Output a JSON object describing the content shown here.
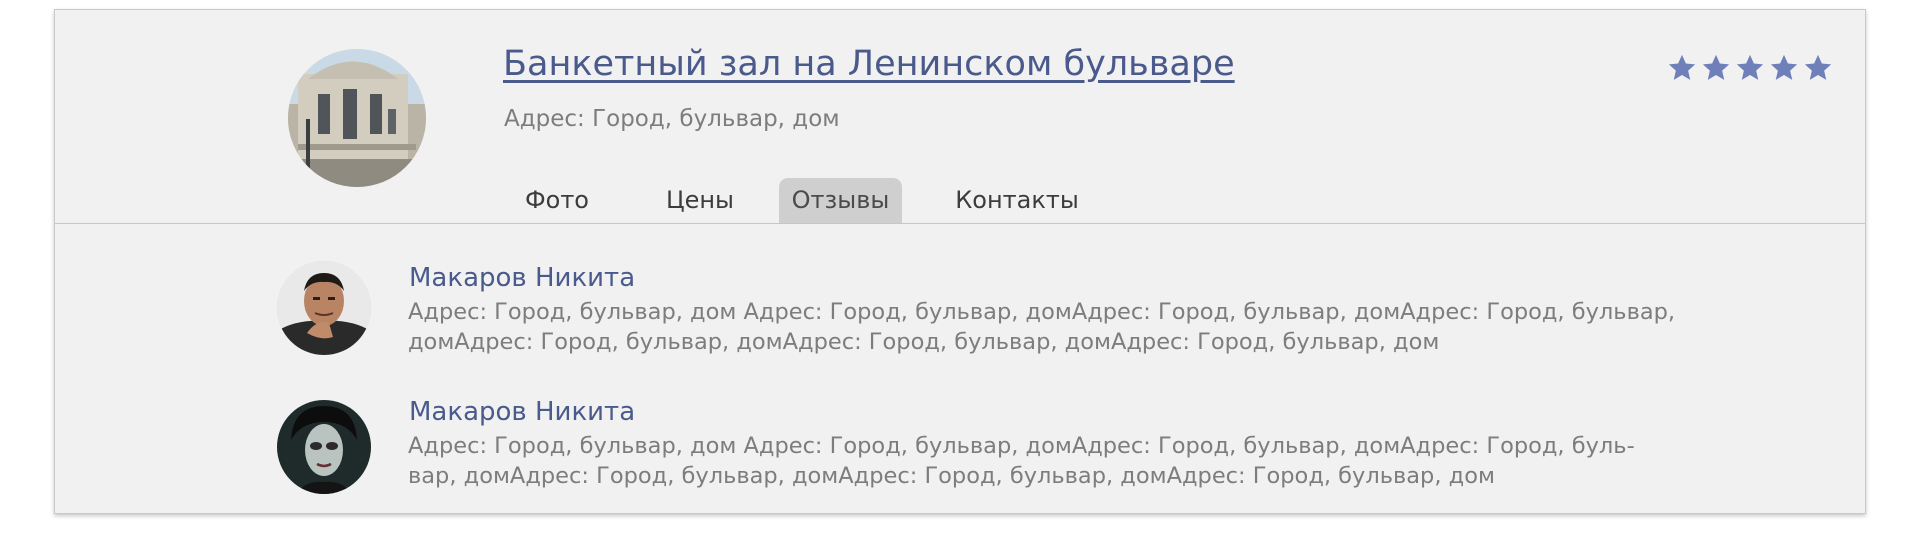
{
  "venue": {
    "title": "Банкетный зал на Ленинском бульваре",
    "address": "Адрес: Город, бульвар, дом",
    "rating": 5,
    "rating_max": 5
  },
  "tabs": [
    {
      "label": "Фото",
      "active": false
    },
    {
      "label": "Цены",
      "active": false
    },
    {
      "label": "Отзывы",
      "active": true
    },
    {
      "label": "Контакты",
      "active": false
    }
  ],
  "reviews": [
    {
      "author": "Макаров Никита",
      "text_lines": [
        "Адрес: Город, бульвар, дом Адрес: Город, бульвар, домАдрес: Город, бульвар, домАдрес: Город, бульвар,",
        "домАдрес: Город, бульвар, домАдрес: Город, бульвар, домАдрес: Город, бульвар, дом"
      ]
    },
    {
      "author": "Макаров Никита",
      "text_lines": [
        "Адрес: Город, бульвар, дом Адрес: Город, бульвар, домАдрес: Город, бульвар, домАдрес: Город, буль-",
        "вар, домАдрес: Город, бульвар, домАдрес: Город, бульвар, домАдрес: Город, бульвар, дом"
      ]
    }
  ],
  "colors": {
    "accent": "#4a5a8c",
    "star": "#6e7fb9",
    "card_bg": "#f1f1f1",
    "active_tab_bg": "#cfcfcf",
    "muted_text": "#7d7d7d"
  }
}
